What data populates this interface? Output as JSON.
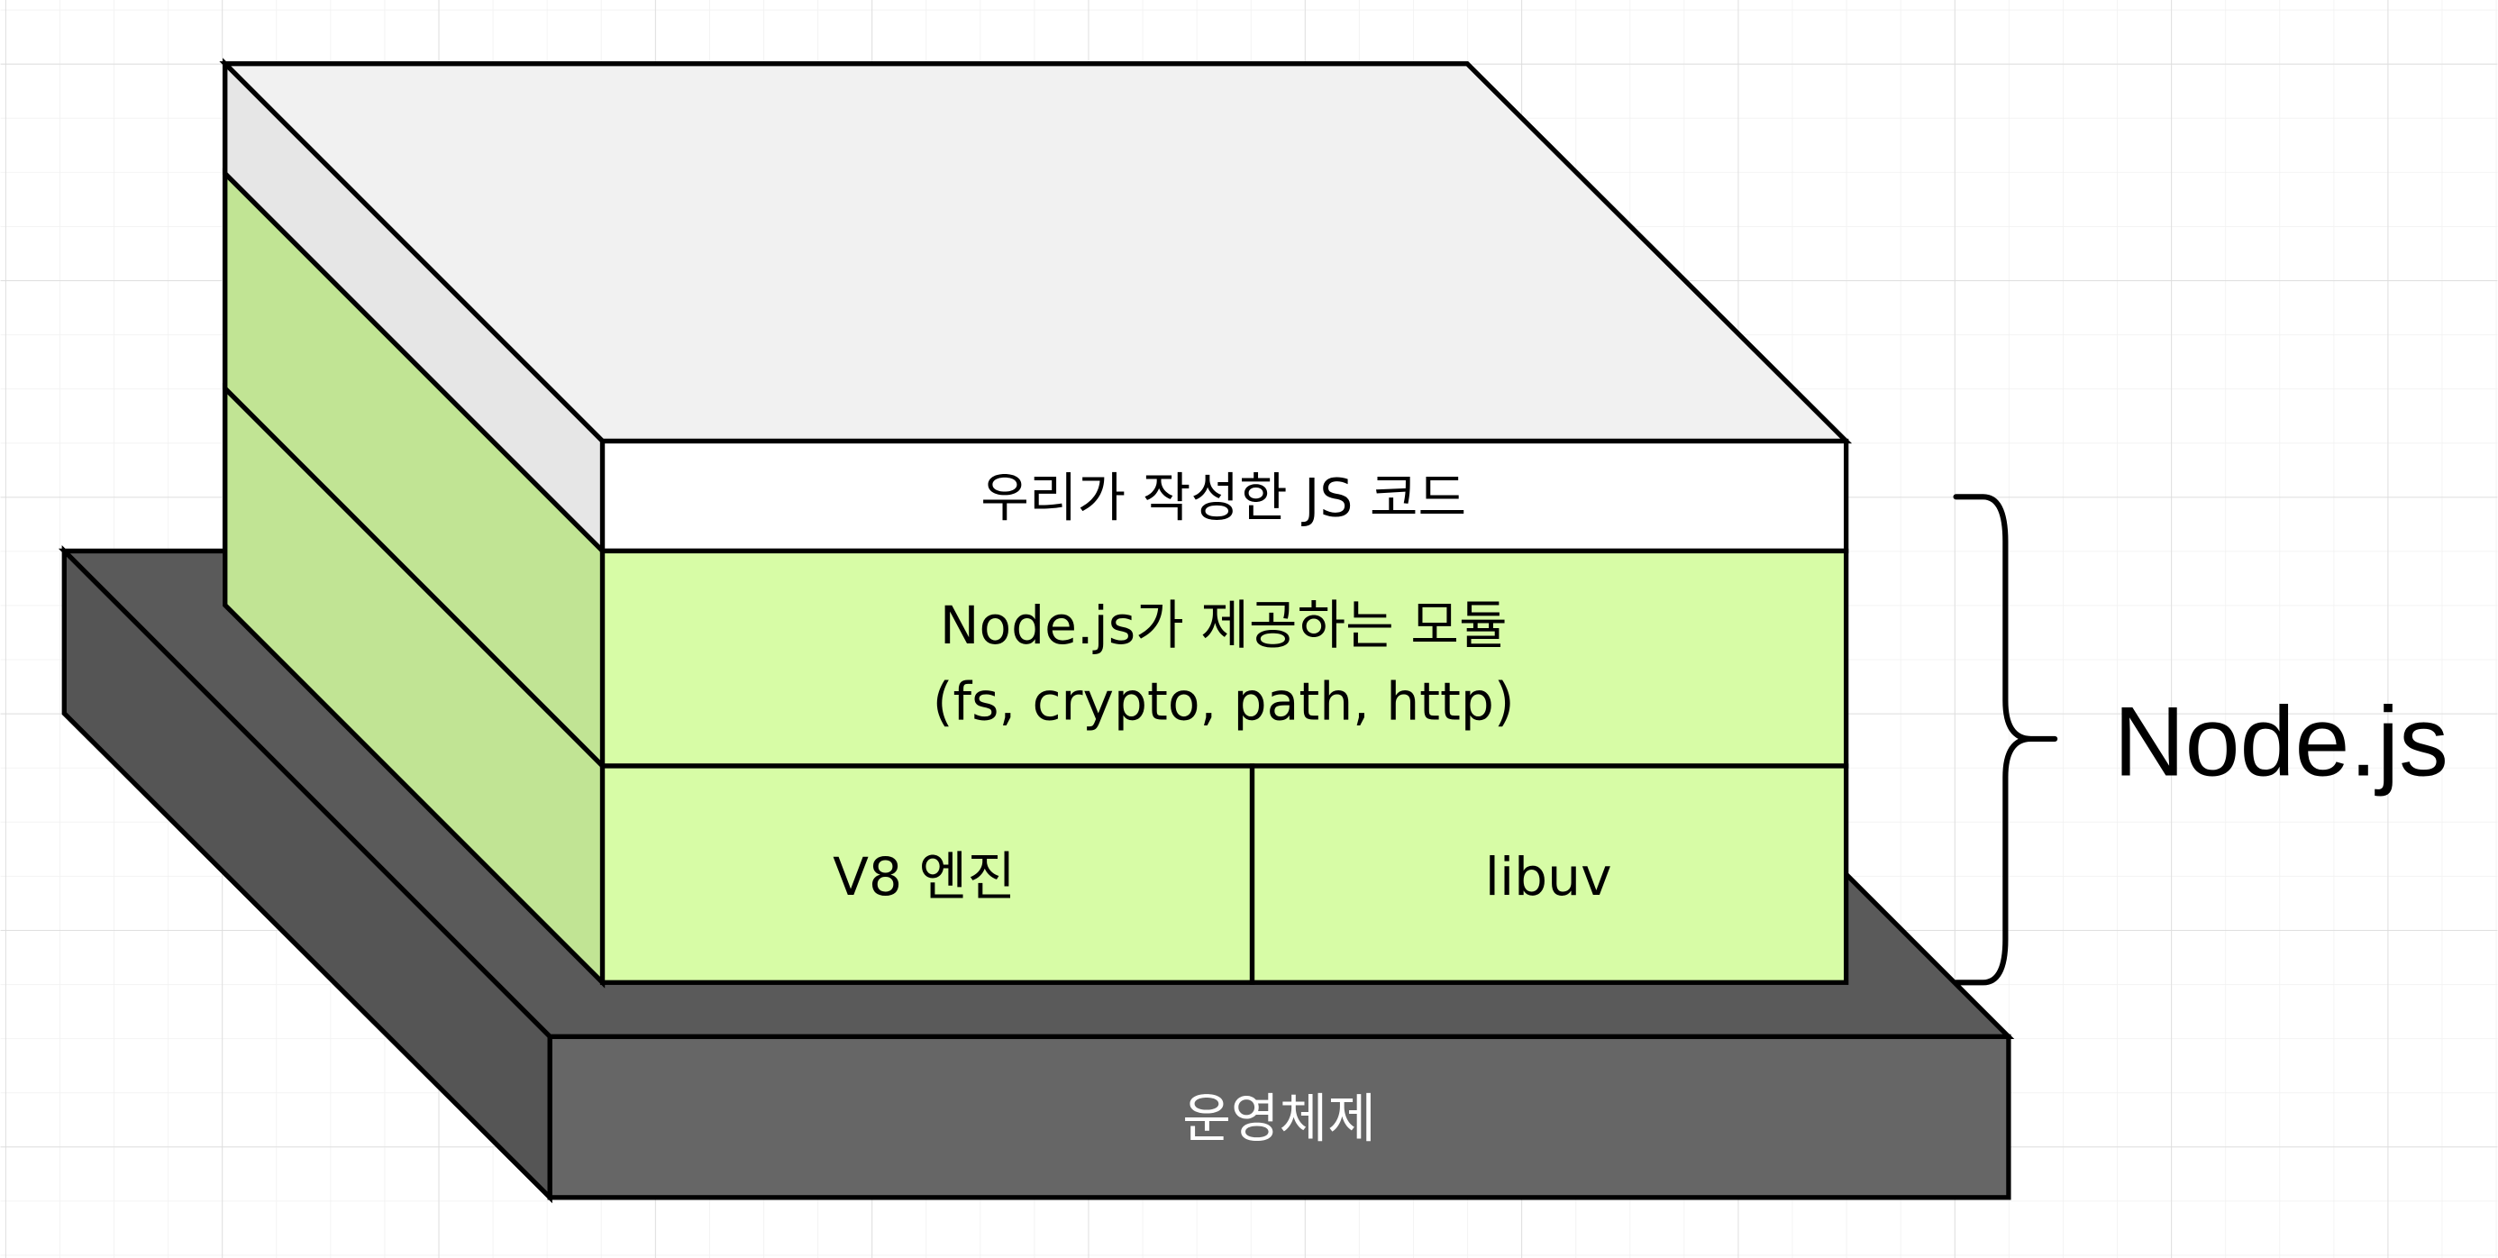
{
  "diagram": {
    "layers": {
      "user_code": "우리가 작성한 JS 코드",
      "modules_line1": "Node.js가 제공하는 모듈",
      "modules_line2": "(fs, crypto, path, http)",
      "v8": "V8 엔진",
      "libuv": "libuv",
      "os": "운영체제"
    },
    "brace_label": "Node.js",
    "colors": {
      "top_face": "#f1f1f1",
      "white_side": "#e6e6e6",
      "green_front": "#d7fca6",
      "green_side": "#c1e494",
      "os_front": "#666666",
      "os_top": "#5a5a5a",
      "os_side": "#555555",
      "grid_minor": "#f2f2f2",
      "grid_major": "#dcdcdc"
    }
  }
}
